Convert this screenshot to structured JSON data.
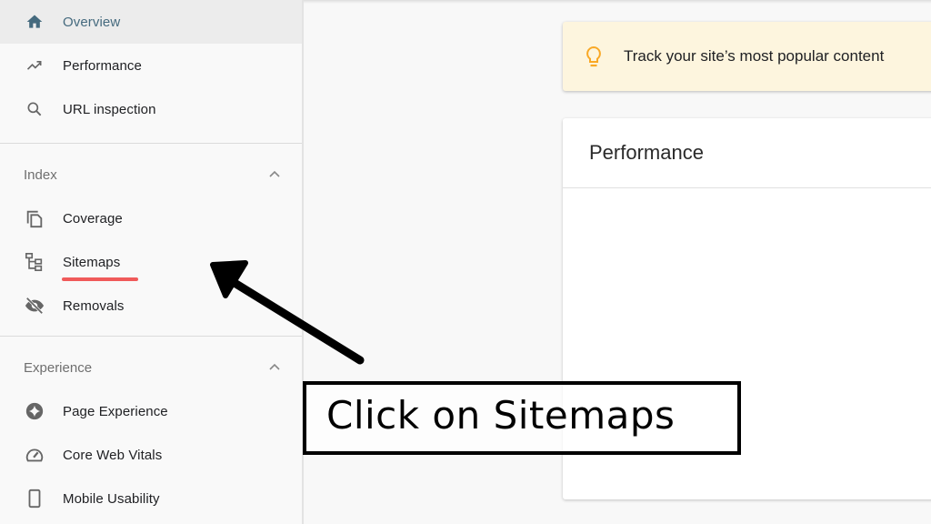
{
  "sidebar": {
    "top_items": [
      {
        "label": "Overview",
        "icon": "home-icon",
        "active": true
      },
      {
        "label": "Performance",
        "icon": "trending-up-icon"
      },
      {
        "label": "URL inspection",
        "icon": "search-icon"
      }
    ],
    "sections": [
      {
        "title": "Index",
        "expanded": true,
        "items": [
          {
            "label": "Coverage",
            "icon": "copy-pages-icon"
          },
          {
            "label": "Sitemaps",
            "icon": "sitemap-icon"
          },
          {
            "label": "Removals",
            "icon": "eye-off-icon"
          }
        ]
      },
      {
        "title": "Experience",
        "expanded": true,
        "items": [
          {
            "label": "Page Experience",
            "icon": "page-experience-icon"
          },
          {
            "label": "Core Web Vitals",
            "icon": "gauge-icon"
          },
          {
            "label": "Mobile Usability",
            "icon": "phone-icon"
          }
        ]
      }
    ]
  },
  "main": {
    "tip": {
      "text": "Track your site’s most popular content",
      "icon": "lightbulb-icon"
    },
    "performance_card": {
      "title": "Performance"
    }
  },
  "annotation": {
    "callout_text": "Click on Sitemaps",
    "highlight_color": "#f05a5a"
  },
  "colors": {
    "active_nav": "#456a7e",
    "tip_background": "#fdf5de",
    "tip_icon": "#f9a825"
  }
}
